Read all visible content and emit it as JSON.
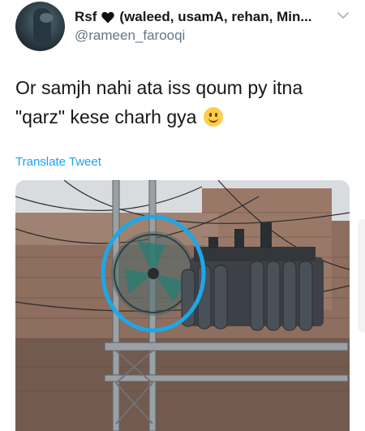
{
  "tweet": {
    "display_name": "Rsf",
    "name_rest": "(waleed, usamA, rehan, Min...",
    "handle": "@rameen_farooqi",
    "text": "Or samjh nahi ata iss qoum py itna \"qarz\" kese charh gya",
    "emoji": "slightly-smiling-face-emoji",
    "translate_label": "Translate Tweet"
  },
  "icons": {
    "heart": "black-heart-icon",
    "menu": "chevron-down-icon"
  },
  "colors": {
    "link": "#1da1f2",
    "handle": "#657786",
    "text": "#14171a",
    "highlight_circle": "#1ea7e6"
  }
}
